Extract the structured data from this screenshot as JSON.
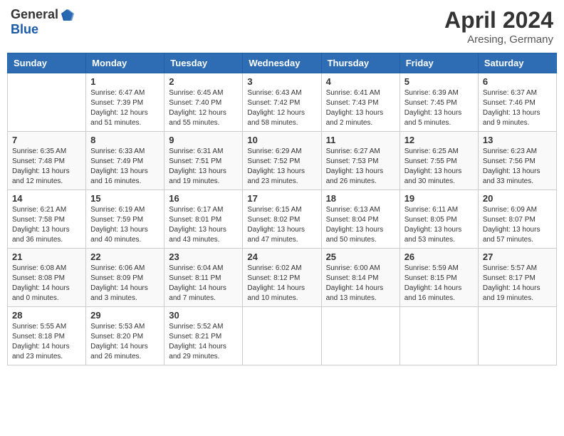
{
  "header": {
    "logo": {
      "general": "General",
      "blue": "Blue"
    },
    "title": "April 2024",
    "location": "Aresing, Germany"
  },
  "columns": [
    "Sunday",
    "Monday",
    "Tuesday",
    "Wednesday",
    "Thursday",
    "Friday",
    "Saturday"
  ],
  "weeks": [
    [
      {
        "day": "",
        "sunrise": "",
        "sunset": "",
        "daylight": ""
      },
      {
        "day": "1",
        "sunrise": "Sunrise: 6:47 AM",
        "sunset": "Sunset: 7:39 PM",
        "daylight": "Daylight: 12 hours and 51 minutes."
      },
      {
        "day": "2",
        "sunrise": "Sunrise: 6:45 AM",
        "sunset": "Sunset: 7:40 PM",
        "daylight": "Daylight: 12 hours and 55 minutes."
      },
      {
        "day": "3",
        "sunrise": "Sunrise: 6:43 AM",
        "sunset": "Sunset: 7:42 PM",
        "daylight": "Daylight: 12 hours and 58 minutes."
      },
      {
        "day": "4",
        "sunrise": "Sunrise: 6:41 AM",
        "sunset": "Sunset: 7:43 PM",
        "daylight": "Daylight: 13 hours and 2 minutes."
      },
      {
        "day": "5",
        "sunrise": "Sunrise: 6:39 AM",
        "sunset": "Sunset: 7:45 PM",
        "daylight": "Daylight: 13 hours and 5 minutes."
      },
      {
        "day": "6",
        "sunrise": "Sunrise: 6:37 AM",
        "sunset": "Sunset: 7:46 PM",
        "daylight": "Daylight: 13 hours and 9 minutes."
      }
    ],
    [
      {
        "day": "7",
        "sunrise": "Sunrise: 6:35 AM",
        "sunset": "Sunset: 7:48 PM",
        "daylight": "Daylight: 13 hours and 12 minutes."
      },
      {
        "day": "8",
        "sunrise": "Sunrise: 6:33 AM",
        "sunset": "Sunset: 7:49 PM",
        "daylight": "Daylight: 13 hours and 16 minutes."
      },
      {
        "day": "9",
        "sunrise": "Sunrise: 6:31 AM",
        "sunset": "Sunset: 7:51 PM",
        "daylight": "Daylight: 13 hours and 19 minutes."
      },
      {
        "day": "10",
        "sunrise": "Sunrise: 6:29 AM",
        "sunset": "Sunset: 7:52 PM",
        "daylight": "Daylight: 13 hours and 23 minutes."
      },
      {
        "day": "11",
        "sunrise": "Sunrise: 6:27 AM",
        "sunset": "Sunset: 7:53 PM",
        "daylight": "Daylight: 13 hours and 26 minutes."
      },
      {
        "day": "12",
        "sunrise": "Sunrise: 6:25 AM",
        "sunset": "Sunset: 7:55 PM",
        "daylight": "Daylight: 13 hours and 30 minutes."
      },
      {
        "day": "13",
        "sunrise": "Sunrise: 6:23 AM",
        "sunset": "Sunset: 7:56 PM",
        "daylight": "Daylight: 13 hours and 33 minutes."
      }
    ],
    [
      {
        "day": "14",
        "sunrise": "Sunrise: 6:21 AM",
        "sunset": "Sunset: 7:58 PM",
        "daylight": "Daylight: 13 hours and 36 minutes."
      },
      {
        "day": "15",
        "sunrise": "Sunrise: 6:19 AM",
        "sunset": "Sunset: 7:59 PM",
        "daylight": "Daylight: 13 hours and 40 minutes."
      },
      {
        "day": "16",
        "sunrise": "Sunrise: 6:17 AM",
        "sunset": "Sunset: 8:01 PM",
        "daylight": "Daylight: 13 hours and 43 minutes."
      },
      {
        "day": "17",
        "sunrise": "Sunrise: 6:15 AM",
        "sunset": "Sunset: 8:02 PM",
        "daylight": "Daylight: 13 hours and 47 minutes."
      },
      {
        "day": "18",
        "sunrise": "Sunrise: 6:13 AM",
        "sunset": "Sunset: 8:04 PM",
        "daylight": "Daylight: 13 hours and 50 minutes."
      },
      {
        "day": "19",
        "sunrise": "Sunrise: 6:11 AM",
        "sunset": "Sunset: 8:05 PM",
        "daylight": "Daylight: 13 hours and 53 minutes."
      },
      {
        "day": "20",
        "sunrise": "Sunrise: 6:09 AM",
        "sunset": "Sunset: 8:07 PM",
        "daylight": "Daylight: 13 hours and 57 minutes."
      }
    ],
    [
      {
        "day": "21",
        "sunrise": "Sunrise: 6:08 AM",
        "sunset": "Sunset: 8:08 PM",
        "daylight": "Daylight: 14 hours and 0 minutes."
      },
      {
        "day": "22",
        "sunrise": "Sunrise: 6:06 AM",
        "sunset": "Sunset: 8:09 PM",
        "daylight": "Daylight: 14 hours and 3 minutes."
      },
      {
        "day": "23",
        "sunrise": "Sunrise: 6:04 AM",
        "sunset": "Sunset: 8:11 PM",
        "daylight": "Daylight: 14 hours and 7 minutes."
      },
      {
        "day": "24",
        "sunrise": "Sunrise: 6:02 AM",
        "sunset": "Sunset: 8:12 PM",
        "daylight": "Daylight: 14 hours and 10 minutes."
      },
      {
        "day": "25",
        "sunrise": "Sunrise: 6:00 AM",
        "sunset": "Sunset: 8:14 PM",
        "daylight": "Daylight: 14 hours and 13 minutes."
      },
      {
        "day": "26",
        "sunrise": "Sunrise: 5:59 AM",
        "sunset": "Sunset: 8:15 PM",
        "daylight": "Daylight: 14 hours and 16 minutes."
      },
      {
        "day": "27",
        "sunrise": "Sunrise: 5:57 AM",
        "sunset": "Sunset: 8:17 PM",
        "daylight": "Daylight: 14 hours and 19 minutes."
      }
    ],
    [
      {
        "day": "28",
        "sunrise": "Sunrise: 5:55 AM",
        "sunset": "Sunset: 8:18 PM",
        "daylight": "Daylight: 14 hours and 23 minutes."
      },
      {
        "day": "29",
        "sunrise": "Sunrise: 5:53 AM",
        "sunset": "Sunset: 8:20 PM",
        "daylight": "Daylight: 14 hours and 26 minutes."
      },
      {
        "day": "30",
        "sunrise": "Sunrise: 5:52 AM",
        "sunset": "Sunset: 8:21 PM",
        "daylight": "Daylight: 14 hours and 29 minutes."
      },
      {
        "day": "",
        "sunrise": "",
        "sunset": "",
        "daylight": ""
      },
      {
        "day": "",
        "sunrise": "",
        "sunset": "",
        "daylight": ""
      },
      {
        "day": "",
        "sunrise": "",
        "sunset": "",
        "daylight": ""
      },
      {
        "day": "",
        "sunrise": "",
        "sunset": "",
        "daylight": ""
      }
    ]
  ]
}
